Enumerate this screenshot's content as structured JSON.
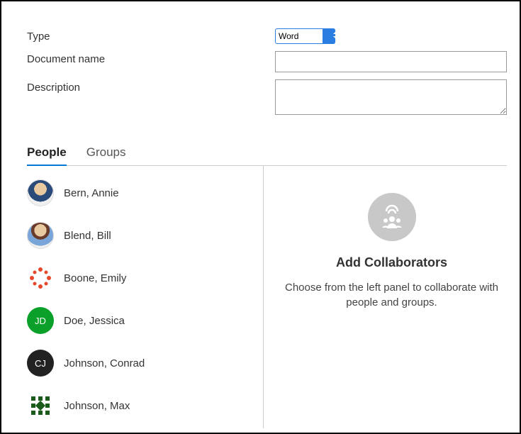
{
  "form": {
    "type_label": "Type",
    "type_value": "Word",
    "docname_label": "Document name",
    "docname_value": "",
    "desc_label": "Description",
    "desc_value": ""
  },
  "tabs": {
    "people": "People",
    "groups": "Groups",
    "active": "people"
  },
  "people": [
    {
      "name": "Bern, Annie",
      "avatar_type": "photo",
      "avatar_key": "annie"
    },
    {
      "name": "Blend, Bill",
      "avatar_type": "photo",
      "avatar_key": "bill"
    },
    {
      "name": "Boone, Emily",
      "avatar_type": "pattern",
      "avatar_key": "emily"
    },
    {
      "name": "Doe, Jessica",
      "avatar_type": "initials",
      "initials": "JD",
      "bg": "#0aa02a"
    },
    {
      "name": "Johnson, Conrad",
      "avatar_type": "initials",
      "initials": "CJ",
      "bg": "#222"
    },
    {
      "name": "Johnson, Max",
      "avatar_type": "pattern",
      "avatar_key": "max"
    }
  ],
  "collab": {
    "title": "Add Collaborators",
    "text": "Choose from the left panel to collaborate with people and groups."
  }
}
